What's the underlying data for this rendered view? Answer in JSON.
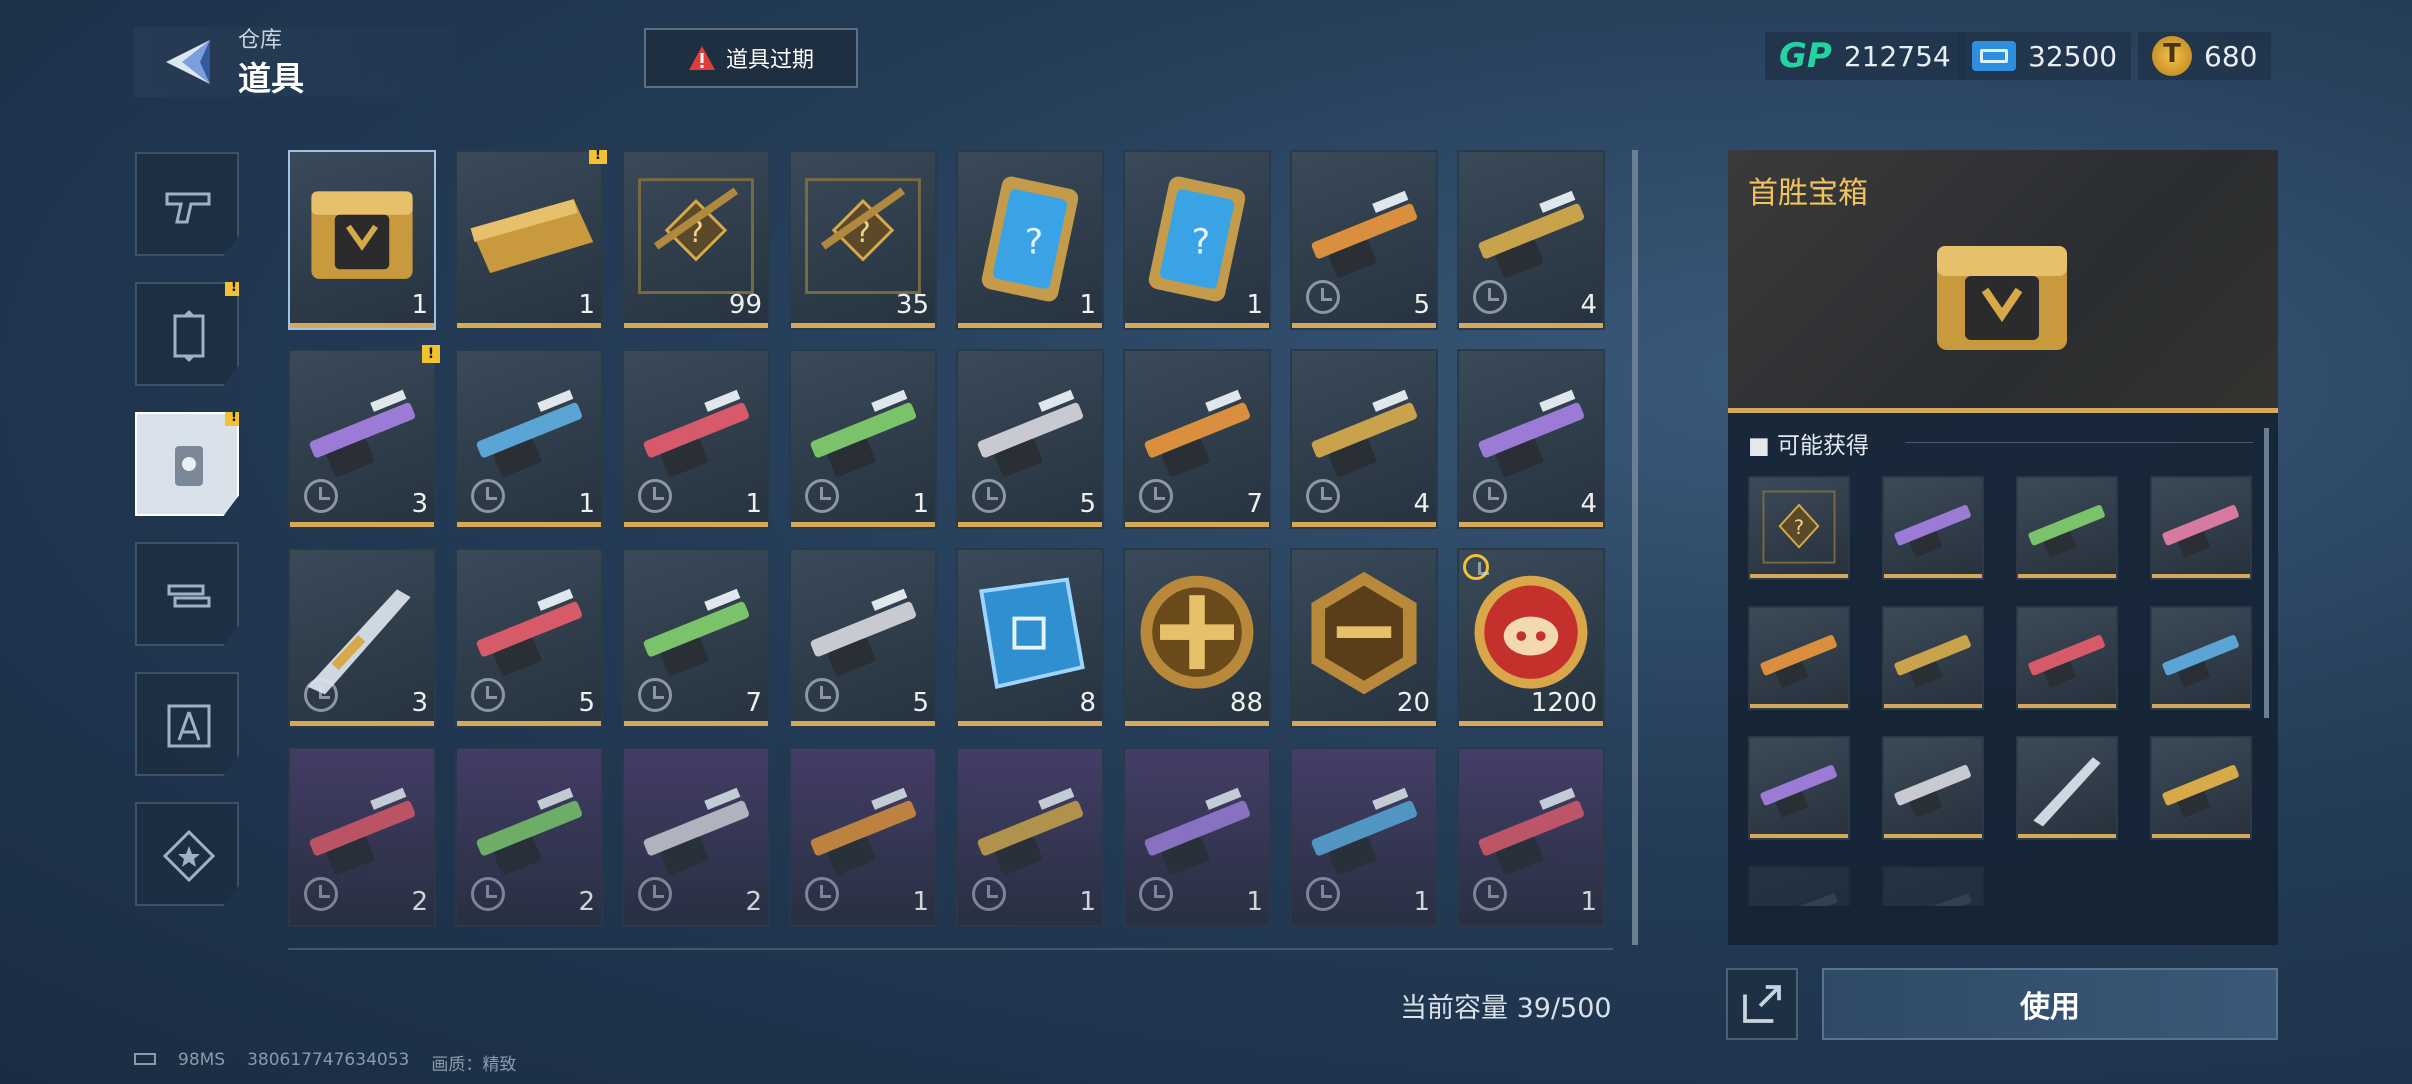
{
  "header": {
    "subtitle": "仓库",
    "title": "道具",
    "expire_label": "道具过期"
  },
  "currencies": {
    "gp_logo": "GP",
    "gp": "212754",
    "ticket": "32500",
    "coin": "680"
  },
  "side_tabs": [
    {
      "icon": "pistol-icon",
      "active": false,
      "badge": false
    },
    {
      "icon": "card-frame-icon",
      "active": false,
      "badge": true
    },
    {
      "icon": "item-pack-icon",
      "active": true,
      "badge": true
    },
    {
      "icon": "weapon-swap-icon",
      "active": false,
      "badge": false
    },
    {
      "icon": "compass-blueprint-icon",
      "active": false,
      "badge": false
    },
    {
      "icon": "star-badge-icon",
      "active": false,
      "badge": false
    }
  ],
  "items": [
    {
      "name": "首胜宝箱",
      "icon": "gold-chest-icon",
      "count": "1"
    },
    {
      "name": "gold-crate",
      "icon": "gold-crate-icon",
      "count": "1",
      "alert": true
    },
    {
      "name": "blueprint-rifle",
      "icon": "blueprint-rifle-icon",
      "count": "99"
    },
    {
      "name": "blueprint-rifle",
      "icon": "blueprint-rifle-icon",
      "count": "35"
    },
    {
      "name": "mystery-card",
      "icon": "mystery-card-icon",
      "count": "1"
    },
    {
      "name": "mystery-card",
      "icon": "mystery-card-icon",
      "count": "1"
    },
    {
      "name": "gold-minigun",
      "icon": "gun-icon",
      "count": "5",
      "timed": true
    },
    {
      "name": "red-rifle",
      "icon": "gun-icon",
      "count": "4",
      "timed": true
    },
    {
      "name": "blue-rifle",
      "icon": "gun-icon",
      "count": "3",
      "timed": true,
      "alert": true
    },
    {
      "name": "purple-smg",
      "icon": "gun-icon",
      "count": "1",
      "timed": true
    },
    {
      "name": "silver-rifle",
      "icon": "gun-icon",
      "count": "1",
      "timed": true
    },
    {
      "name": "camo-rifle",
      "icon": "gun-icon",
      "count": "1",
      "timed": true
    },
    {
      "name": "purple-rifle",
      "icon": "gun-icon",
      "count": "5",
      "timed": true
    },
    {
      "name": "pink-rifle",
      "icon": "gun-icon",
      "count": "7",
      "timed": true
    },
    {
      "name": "green-rifle",
      "icon": "gun-icon",
      "count": "4",
      "timed": true
    },
    {
      "name": "gold-rifle",
      "icon": "gun-icon",
      "count": "4",
      "timed": true
    },
    {
      "name": "knife",
      "icon": "knife-icon",
      "count": "3",
      "timed": true
    },
    {
      "name": "gold-sniper",
      "icon": "gun-icon",
      "count": "5",
      "timed": true
    },
    {
      "name": "dark-rifle",
      "icon": "gun-icon",
      "count": "7",
      "timed": true
    },
    {
      "name": "tan-rifle",
      "icon": "gun-icon",
      "count": "5",
      "timed": true
    },
    {
      "name": "blue-chip",
      "icon": "circuit-chip-icon",
      "count": "8"
    },
    {
      "name": "gold-cross-coin",
      "icon": "gold-cross-coin-icon",
      "count": "88"
    },
    {
      "name": "hex-gun-badge",
      "icon": "hex-gun-badge-icon",
      "count": "20"
    },
    {
      "name": "pig-coin",
      "icon": "pig-coin-icon",
      "count": "1200",
      "clock_top": true
    },
    {
      "name": "white-rifle",
      "icon": "gun-icon",
      "count": "2",
      "timed": true,
      "purple": true
    },
    {
      "name": "silver-smg",
      "icon": "gun-icon",
      "count": "2",
      "timed": true,
      "purple": true
    },
    {
      "name": "black-rifle",
      "icon": "gun-icon",
      "count": "2",
      "timed": true,
      "purple": true
    },
    {
      "name": "grey-rifle",
      "icon": "gun-icon",
      "count": "1",
      "timed": true,
      "purple": true
    },
    {
      "name": "rocket-launcher",
      "icon": "gun-icon",
      "count": "1",
      "timed": true,
      "purple": true
    },
    {
      "name": "shotgun",
      "icon": "gun-icon",
      "count": "1",
      "timed": true,
      "purple": true
    },
    {
      "name": "green-smg",
      "icon": "gun-icon",
      "count": "1",
      "timed": true,
      "purple": true
    },
    {
      "name": "heavy-rifle",
      "icon": "gun-icon",
      "count": "1",
      "timed": true,
      "purple": true
    }
  ],
  "capacity": "当前容量 39/500",
  "detail": {
    "title": "首胜宝箱",
    "possible_label": "可能获得",
    "rewards": [
      "blueprint-rifle-icon",
      "purple-rifle-icon",
      "green-rifle-icon",
      "pink-rifle-icon",
      "gold-rifle-icon",
      "gold-minigun-icon",
      "red-rifle-icon",
      "blue-rifle-icon",
      "purple-smg-icon",
      "dark-rifle-icon",
      "knife-icon",
      "gold-sniper-icon",
      "partial-icon",
      "partial-icon"
    ],
    "use_label": "使用"
  },
  "footer": {
    "ping": "98MS",
    "id": "380617747634053",
    "quality": "画质：精致"
  },
  "colors": {
    "accent_gold": "#d6a85a",
    "title_gold": "#f1c35c",
    "gp_green": "#22d4a2",
    "badge_yellow": "#f2c230"
  }
}
